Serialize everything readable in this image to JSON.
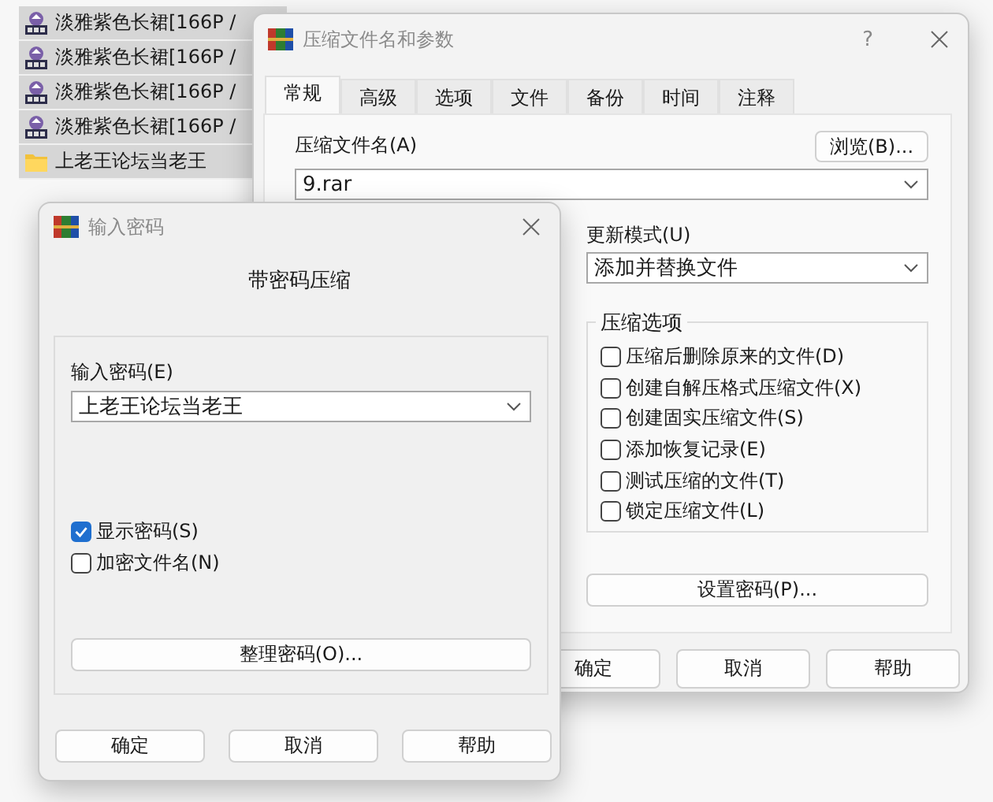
{
  "file_list": {
    "items": [
      {
        "kind": "archive",
        "name": "淡雅紫色长裙[166P /"
      },
      {
        "kind": "archive",
        "name": "淡雅紫色长裙[166P /"
      },
      {
        "kind": "archive",
        "name": "淡雅紫色长裙[166P /"
      },
      {
        "kind": "archive",
        "name": "淡雅紫色长裙[166P /"
      },
      {
        "kind": "folder",
        "name": "上老王论坛当老王"
      }
    ]
  },
  "archive_dialog": {
    "title": "压缩文件名和参数",
    "help_glyph": "?",
    "tabs": [
      {
        "label": "常规",
        "selected": true
      },
      {
        "label": "高级",
        "selected": false
      },
      {
        "label": "选项",
        "selected": false
      },
      {
        "label": "文件",
        "selected": false
      },
      {
        "label": "备份",
        "selected": false
      },
      {
        "label": "时间",
        "selected": false
      },
      {
        "label": "注释",
        "selected": false
      }
    ],
    "archive_name_label": "压缩文件名(A)",
    "browse_button": "浏览(B)...",
    "archive_name": "9.rar",
    "update_mode_label": "更新模式(U)",
    "update_mode": "添加并替换文件",
    "options_group": {
      "title": "压缩选项",
      "options": [
        {
          "label": "压缩后删除原来的文件(D)",
          "checked": false
        },
        {
          "label": "创建自解压格式压缩文件(X)",
          "checked": false
        },
        {
          "label": "创建固实压缩文件(S)",
          "checked": false
        },
        {
          "label": "添加恢复记录(E)",
          "checked": false
        },
        {
          "label": "测试压缩的文件(T)",
          "checked": false
        },
        {
          "label": "锁定压缩文件(L)",
          "checked": false
        }
      ]
    },
    "set_password_button": "设置密码(P)...",
    "buttons": [
      "确定",
      "取消",
      "帮助"
    ]
  },
  "password_dialog": {
    "title": "输入密码",
    "heading": "带密码压缩",
    "password_label": "输入密码(E)",
    "password": "上老王论坛当老王",
    "options": [
      {
        "label": "显示密码(S)",
        "checked": true
      },
      {
        "label": "加密文件名(N)",
        "checked": false
      }
    ],
    "organize_button": "整理密码(O)...",
    "buttons": [
      "确定",
      "取消",
      "帮助"
    ]
  }
}
